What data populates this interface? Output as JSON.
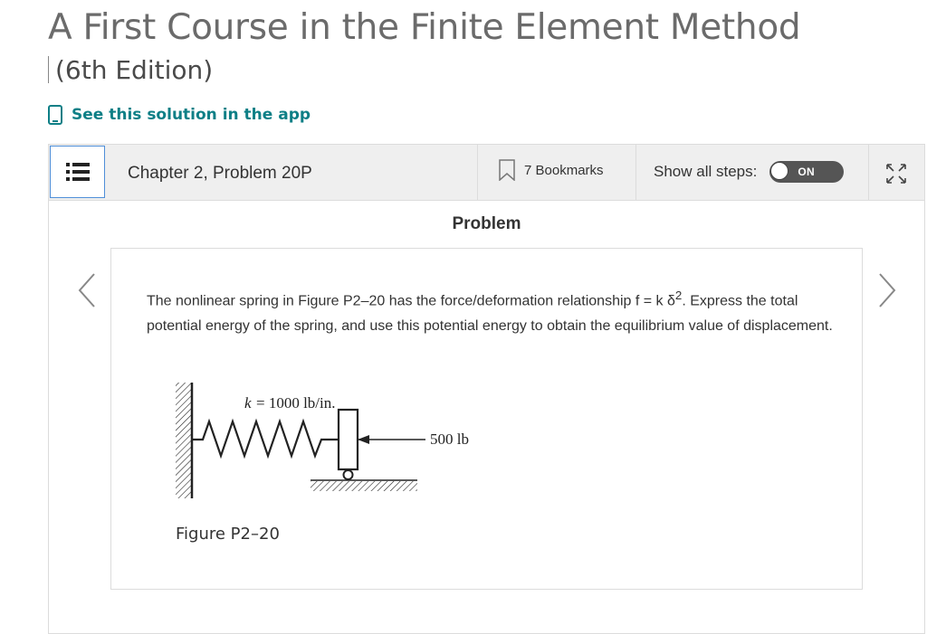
{
  "book": {
    "title": "A First Course in the Finite Element Method",
    "edition": "(6th Edition)"
  },
  "app_link": {
    "label": "See this solution in the app",
    "icon": "phone-icon"
  },
  "toolbar": {
    "toc_icon": "list-icon",
    "chapter": "Chapter 2, Problem 20P",
    "bookmarks": "7 Bookmarks",
    "bookmark_icon": "bookmark-icon",
    "show_steps_label": "Show all steps:",
    "toggle_state": "ON",
    "expand_icon": "expand-icon"
  },
  "problem": {
    "heading": "Problem",
    "text_before_sup": "The nonlinear spring in Figure P2–20 has the force/deformation relationship f = k δ",
    "sup": "2",
    "text_after_sup": ". Express the total potential energy of the spring, and use this potential energy to obtain the equilibrium value of displacement.",
    "figure": {
      "spring_label_k": "k",
      "spring_label_value": "= 1000 lb/in.",
      "force_label": "500 lb",
      "caption": "Figure P2–20"
    }
  },
  "nav": {
    "prev_icon": "chevron-left-icon",
    "next_icon": "chevron-right-icon"
  },
  "colors": {
    "accent": "#0e7f86",
    "toolbar_bg": "#efefef",
    "toc_border": "#4f8fd8",
    "toggle_bg": "#555555"
  }
}
